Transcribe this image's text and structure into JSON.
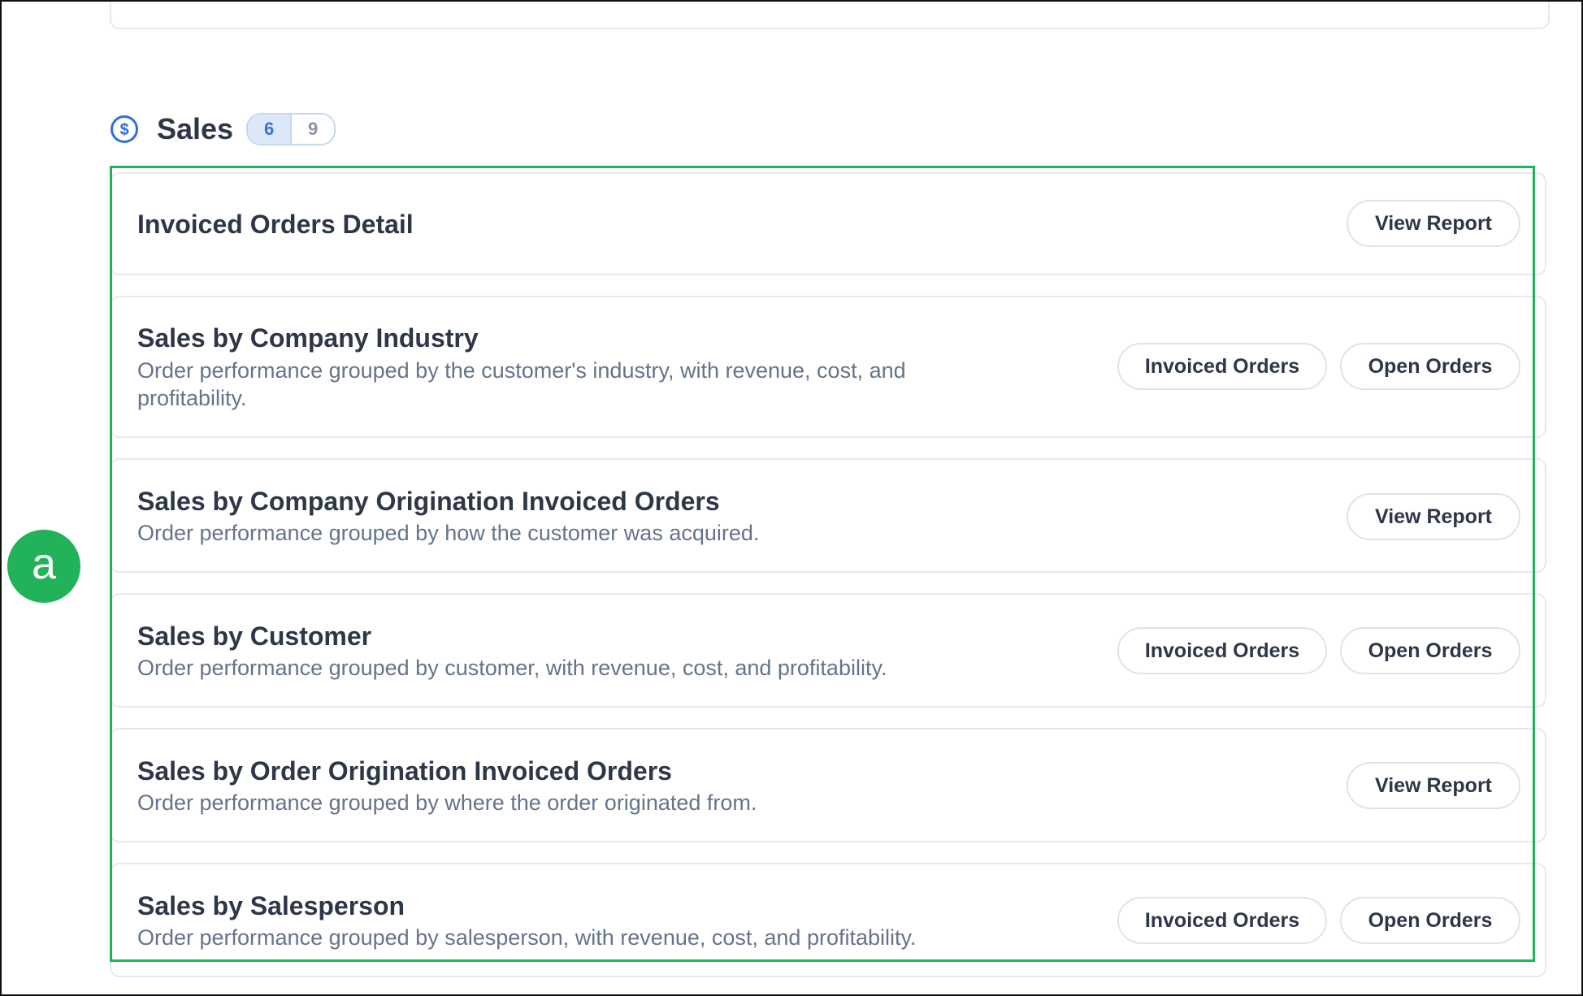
{
  "section": {
    "icon": "dollar-circle-icon",
    "title": "Sales",
    "badge_primary": "6",
    "badge_secondary": "9"
  },
  "reports": [
    {
      "title": "Invoiced Orders Detail",
      "description": "",
      "buttons": [
        "View Report"
      ]
    },
    {
      "title": "Sales by Company Industry",
      "description": "Order performance grouped by the customer's industry, with revenue, cost, and profitability.",
      "buttons": [
        "Invoiced Orders",
        "Open Orders"
      ]
    },
    {
      "title": "Sales by Company Origination Invoiced Orders",
      "description": "Order performance grouped by how the customer was acquired.",
      "buttons": [
        "View Report"
      ]
    },
    {
      "title": "Sales by Customer",
      "description": "Order performance grouped by customer, with revenue, cost, and profitability.",
      "buttons": [
        "Invoiced Orders",
        "Open Orders"
      ]
    },
    {
      "title": "Sales by Order Origination Invoiced Orders",
      "description": "Order performance grouped by where the order originated from.",
      "buttons": [
        "View Report"
      ]
    },
    {
      "title": "Sales by Salesperson",
      "description": "Order performance grouped by salesperson, with revenue, cost, and profitability.",
      "buttons": [
        "Invoiced Orders",
        "Open Orders"
      ]
    }
  ],
  "annotation": {
    "marker_label": "a",
    "highlight_color": "#22b35a"
  },
  "colors": {
    "accent_blue": "#2f6fe0",
    "text_dark": "#2d3748",
    "text_muted": "#64748b"
  }
}
